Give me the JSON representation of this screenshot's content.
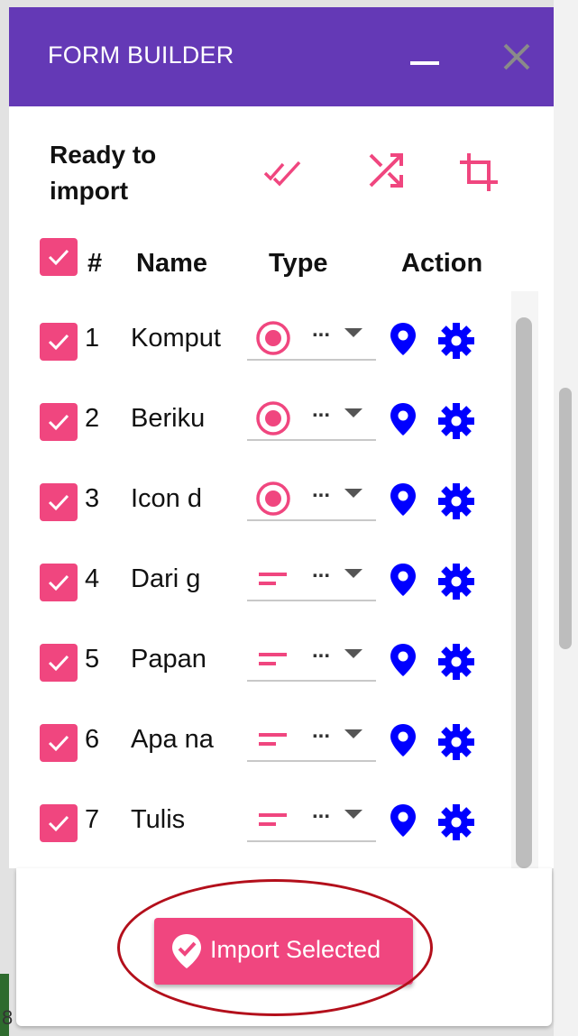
{
  "window": {
    "title": "FORM BUILDER"
  },
  "toolbar": {
    "heading": "Ready to import",
    "select_all_icon": "double-check-icon",
    "shuffle_icon": "shuffle-icon",
    "crop_icon": "crop-icon"
  },
  "table": {
    "columns": [
      "#",
      "Name",
      "Type",
      "Action"
    ],
    "header_checkbox_checked": true,
    "rows": [
      {
        "num": "1",
        "name": "Komput",
        "type_icon": "radio-icon",
        "type_value": "...",
        "checked": true
      },
      {
        "num": "2",
        "name": "Beriku",
        "type_icon": "radio-icon",
        "type_value": "...",
        "checked": true
      },
      {
        "num": "3",
        "name": "Icon d",
        "type_icon": "radio-icon",
        "type_value": "...",
        "checked": true
      },
      {
        "num": "4",
        "name": "Dari g",
        "type_icon": "short-text-icon",
        "type_value": "...",
        "checked": true
      },
      {
        "num": "5",
        "name": "Papan",
        "type_icon": "short-text-icon",
        "type_value": "...",
        "checked": true
      },
      {
        "num": "6",
        "name": "Apa na",
        "type_icon": "short-text-icon",
        "type_value": "...",
        "checked": true
      },
      {
        "num": "7",
        "name": "Tulis",
        "type_icon": "short-text-icon",
        "type_value": "...",
        "checked": true
      }
    ],
    "action_icons": [
      "location-pin-icon",
      "gear-icon"
    ]
  },
  "footer": {
    "import_label": "Import Selected",
    "import_icon": "check-badge-icon"
  },
  "colors": {
    "header": "#6439b6",
    "accent": "#f0467f",
    "action_icon": "#0000ff",
    "annotation": "#b30f1b"
  }
}
